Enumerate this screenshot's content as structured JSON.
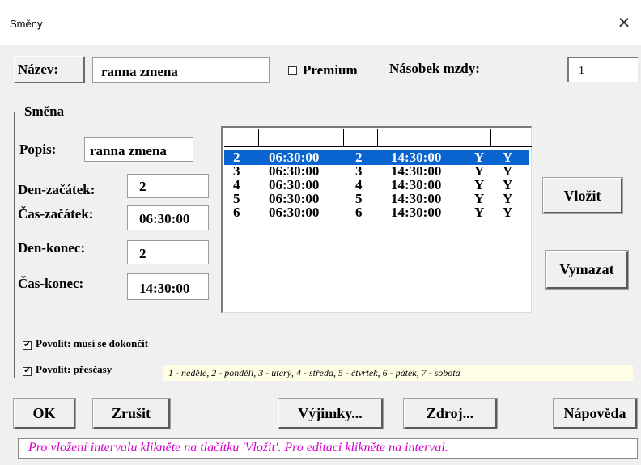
{
  "window": {
    "title": "Směny",
    "close_glyph": "✕"
  },
  "name": {
    "label": "Název:",
    "value": "ranna  zmena"
  },
  "premium": {
    "label": "Premium",
    "checked": false
  },
  "multiplier": {
    "label": "Násobek mzdy:",
    "value": "1"
  },
  "shift_group": {
    "label": "Směna"
  },
  "description": {
    "label": "Popis:",
    "value": "ranna  zmena"
  },
  "start_day": {
    "label": "Den-začátek:",
    "value": "2"
  },
  "start_time": {
    "label": "Čas-začátek:",
    "value": "06:30:00"
  },
  "end_day": {
    "label": "Den-konec:",
    "value": "2"
  },
  "end_time": {
    "label": "Čas-konec:",
    "value": "14:30:00"
  },
  "intervals": {
    "rows": [
      {
        "start_day": "2",
        "start_time": "06:30:00",
        "end_day": "2",
        "end_time": "14:30:00",
        "a": "Y",
        "b": "Y",
        "selected": true
      },
      {
        "start_day": "3",
        "start_time": "06:30:00",
        "end_day": "3",
        "end_time": "14:30:00",
        "a": "Y",
        "b": "Y",
        "selected": false
      },
      {
        "start_day": "4",
        "start_time": "06:30:00",
        "end_day": "4",
        "end_time": "14:30:00",
        "a": "Y",
        "b": "Y",
        "selected": false
      },
      {
        "start_day": "5",
        "start_time": "06:30:00",
        "end_day": "5",
        "end_time": "14:30:00",
        "a": "Y",
        "b": "Y",
        "selected": false
      },
      {
        "start_day": "6",
        "start_time": "06:30:00",
        "end_day": "6",
        "end_time": "14:30:00",
        "a": "Y",
        "b": "Y",
        "selected": false
      }
    ]
  },
  "buttons": {
    "insert": "Vložit",
    "delete": "Vymazat",
    "ok": "OK",
    "cancel": "Zrušit",
    "exceptions": "Výjimky...",
    "source": "Zdroj...",
    "help": "Nápověda"
  },
  "allow_finish": {
    "label": "Povolit: musí se dokončit",
    "checked": true
  },
  "allow_overtime": {
    "label": "Povolit: přesčasy",
    "checked": true
  },
  "day_legend": "1 - neděle, 2 - pondělí, 3 - úterý, 4 - středa, 5 - čtvrtek, 6 - pátek, 7 - sobota",
  "status_text": "Pro vložení intervalu klikněte na tlačítku 'Vložit'. Pro editaci klikněte na interval.",
  "colors": {
    "selection": "#0a64d0",
    "status_text": "#d400c8",
    "hint_bg": "#ffffe6",
    "dialog_bg": "#f0f0f0"
  }
}
